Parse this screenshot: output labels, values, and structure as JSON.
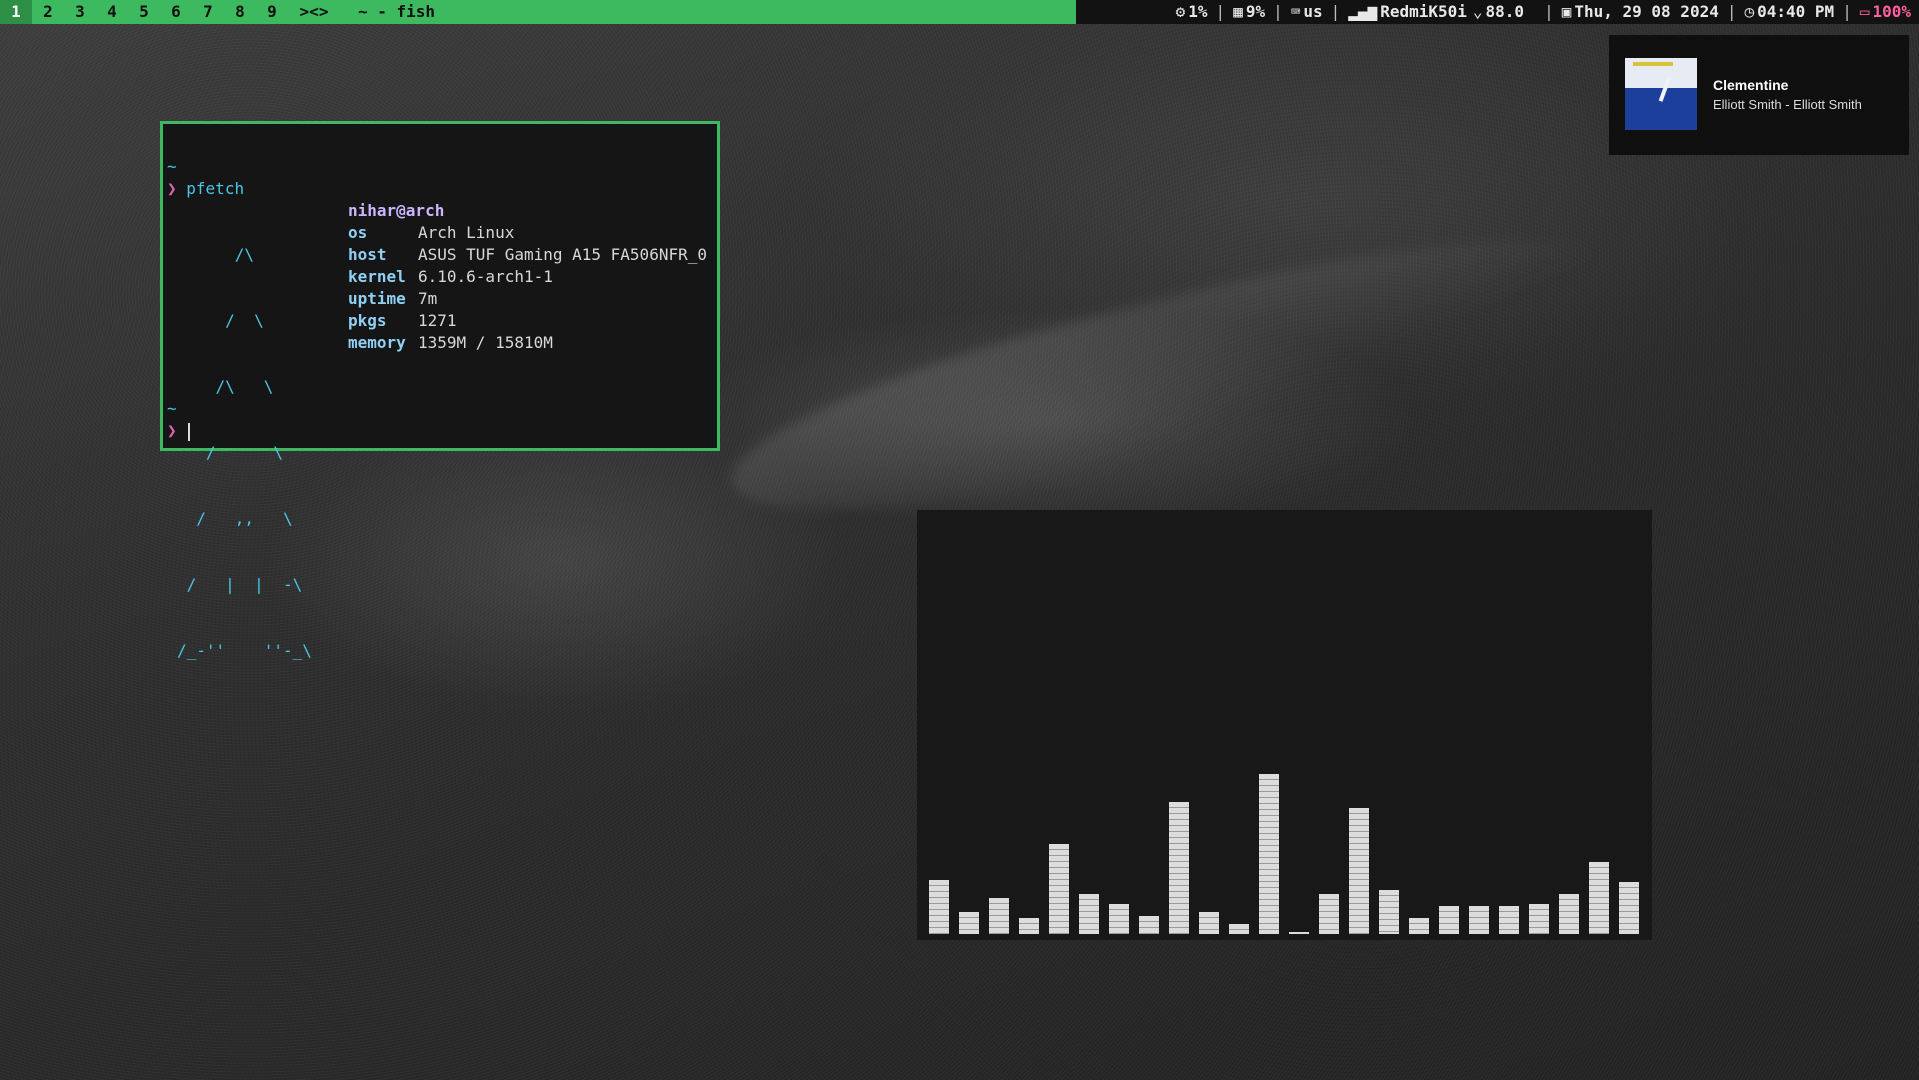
{
  "topbar": {
    "workspaces": [
      {
        "label": "1",
        "active": true
      },
      {
        "label": "2",
        "active": false
      },
      {
        "label": "3",
        "active": false
      },
      {
        "label": "4",
        "active": false
      },
      {
        "label": "5",
        "active": false
      },
      {
        "label": "6",
        "active": false
      },
      {
        "label": "7",
        "active": false
      },
      {
        "label": "8",
        "active": false
      },
      {
        "label": "9",
        "active": false
      }
    ],
    "layout_symbol": "><>",
    "window_title": "~ - fish",
    "cpu": "1%",
    "ram": "9%",
    "keyboard_layout": "us",
    "wifi": "RedmiK50i",
    "network_speed": "88.0",
    "date": "Thu, 29 08 2024",
    "time": "04:40 PM",
    "battery": "100%",
    "colors": {
      "accent": "#3dba5f",
      "battery": "#ff5fa0",
      "bar_bg": "#121212"
    }
  },
  "notification": {
    "title": "Clementine",
    "subtitle": "Elliott Smith - Elliott Smith"
  },
  "terminal": {
    "prompt_dir": "~",
    "prompt_symbol": "❯",
    "command": "pfetch",
    "logo_lines": [
      "      /\\",
      "     /  \\",
      "    /\\   \\",
      "   /      \\",
      "  /   ,,   \\",
      " /   |  |  -\\",
      "/_-''    ''-_\\"
    ],
    "user_host": "nihar@arch",
    "info": [
      {
        "key": "os",
        "value": "Arch Linux"
      },
      {
        "key": "host",
        "value": "ASUS TUF Gaming A15 FA506NFR_0"
      },
      {
        "key": "kernel",
        "value": "6.10.6-arch1-1"
      },
      {
        "key": "uptime",
        "value": "7m"
      },
      {
        "key": "pkgs",
        "value": "1271"
      },
      {
        "key": "memory",
        "value": "1359M / 15810M"
      }
    ],
    "colors": {
      "border": "#3dba5f",
      "logo": "#4ac6e8"
    }
  },
  "visualizer": {
    "levels": [
      0.27,
      0.11,
      0.18,
      0.08,
      0.45,
      0.2,
      0.15,
      0.09,
      0.66,
      0.11,
      0.05,
      0.8,
      0.01,
      0.2,
      0.63,
      0.22,
      0.08,
      0.14,
      0.14,
      0.14,
      0.15,
      0.2,
      0.36,
      0.26
    ]
  }
}
